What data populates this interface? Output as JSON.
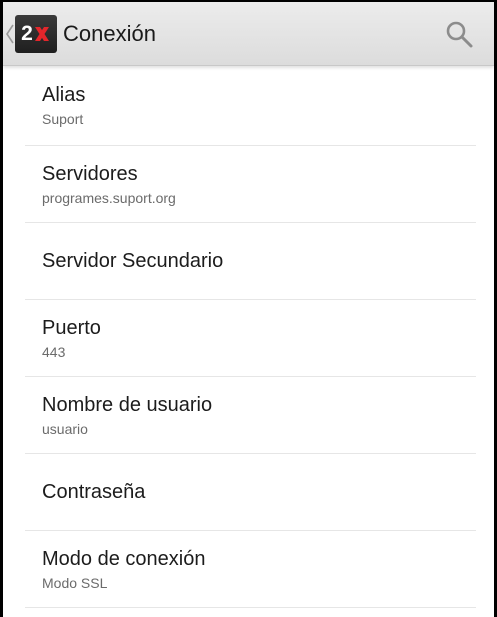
{
  "actionbar": {
    "title": "Conexión",
    "logo_text": "2",
    "logo_icon": "2x-logo-icon",
    "back_icon": "chevron-left-icon",
    "search_icon": "search-icon"
  },
  "colors": {
    "logo_x_red": "#e3262b",
    "actionbar_bg": "#e4e4e4",
    "divider": "#e6e6e6",
    "title_text": "#1c1c1c",
    "summary_text": "#6b6b6b"
  },
  "preferences": [
    {
      "title": "Alias",
      "summary": "Suport"
    },
    {
      "title": "Servidores",
      "summary": "programes.suport.org"
    },
    {
      "title": "Servidor Secundario",
      "summary": ""
    },
    {
      "title": "Puerto",
      "summary": "443"
    },
    {
      "title": "Nombre de usuario",
      "summary": "usuario"
    },
    {
      "title": "Contraseña",
      "summary": ""
    },
    {
      "title": "Modo de conexión",
      "summary": "Modo SSL"
    }
  ]
}
